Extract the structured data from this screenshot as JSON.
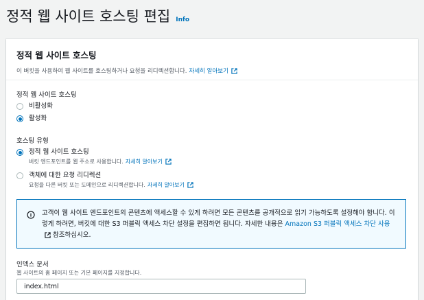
{
  "page": {
    "title": "정적 웹 사이트 호스팅 편집",
    "info_label": "Info"
  },
  "panel": {
    "title": "정적 웹 사이트 호스팅",
    "description": "이 버킷을 사용하여 웹 사이트를 호스팅하거나 요청을 리디렉션합니다.",
    "learn_more": "자세히 알아보기"
  },
  "hosting_toggle": {
    "label": "정적 웹 사이트 호스팅",
    "options": [
      {
        "label": "비활성화",
        "checked": false
      },
      {
        "label": "활성화",
        "checked": true
      }
    ]
  },
  "hosting_type": {
    "label": "호스팅 유형",
    "options": [
      {
        "label": "정적 웹 사이트 호스팅",
        "description": "버킷 엔드포인트를 웹 주소로 사용합니다.",
        "learn_more": "자세히 알아보기",
        "checked": true
      },
      {
        "label": "객체에 대한 요청 리디렉션",
        "description": "요청을 다른 버킷 또는 도메인으로 리디렉션합니다.",
        "learn_more": "자세히 알아보기",
        "checked": false
      }
    ]
  },
  "alert": {
    "text_before": "고객이 웹 사이트 엔드포인트의 콘텐츠에 액세스할 수 있게 하려면 모든 콘텐츠를 공개적으로 읽기 가능하도록 설정해야 합니다. 이렇게 하려면, 버킷에 대한 S3 퍼블릭 액세스 차단 설정을 편집하면 됩니다. 자세한 내용은 ",
    "link_text": "Amazon S3 퍼블릭 액세스 차단 사용",
    "text_after": " 참조하십시오."
  },
  "index_document": {
    "label": "인덱스 문서",
    "description": "웹 사이트의 홈 페이지 또는 기본 페이지를 지정합니다.",
    "value": "index.html"
  },
  "colors": {
    "accent": "#0073bb",
    "alert_bg": "#f1faff",
    "page_bg": "#f2f3f3"
  }
}
